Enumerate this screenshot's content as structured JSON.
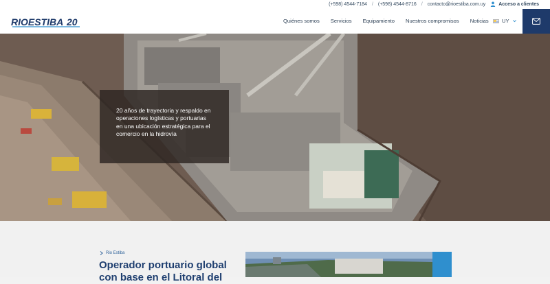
{
  "topbar": {
    "phone1": "(+598) 4544-7184",
    "phone2": "(+598) 4544-8716",
    "email": "contacto@rioestiba.com.uy",
    "separator": "/",
    "client_access": "Acceso a clientes"
  },
  "header": {
    "logo_text": "RIOESTIBA",
    "logo_number": "20",
    "nav": [
      "Quiénes somos",
      "Servicios",
      "Equipamiento",
      "Nuestros compromisos",
      "Noticias"
    ],
    "lang": "UY",
    "mail_icon": "mail-icon"
  },
  "hero": {
    "text": "20 años de trayectoria y respaldo en operaciones logísticas y portuarias en una ubicación estratégica para el comercio en la hidrovía"
  },
  "intro": {
    "breadcrumb": "Rio Estiba",
    "title": "Operador portuario global con base en el Litoral del"
  },
  "colors": {
    "navy": "#1e3a6a",
    "accent_blue": "#2f8fce",
    "title_blue": "#1f3f70"
  }
}
